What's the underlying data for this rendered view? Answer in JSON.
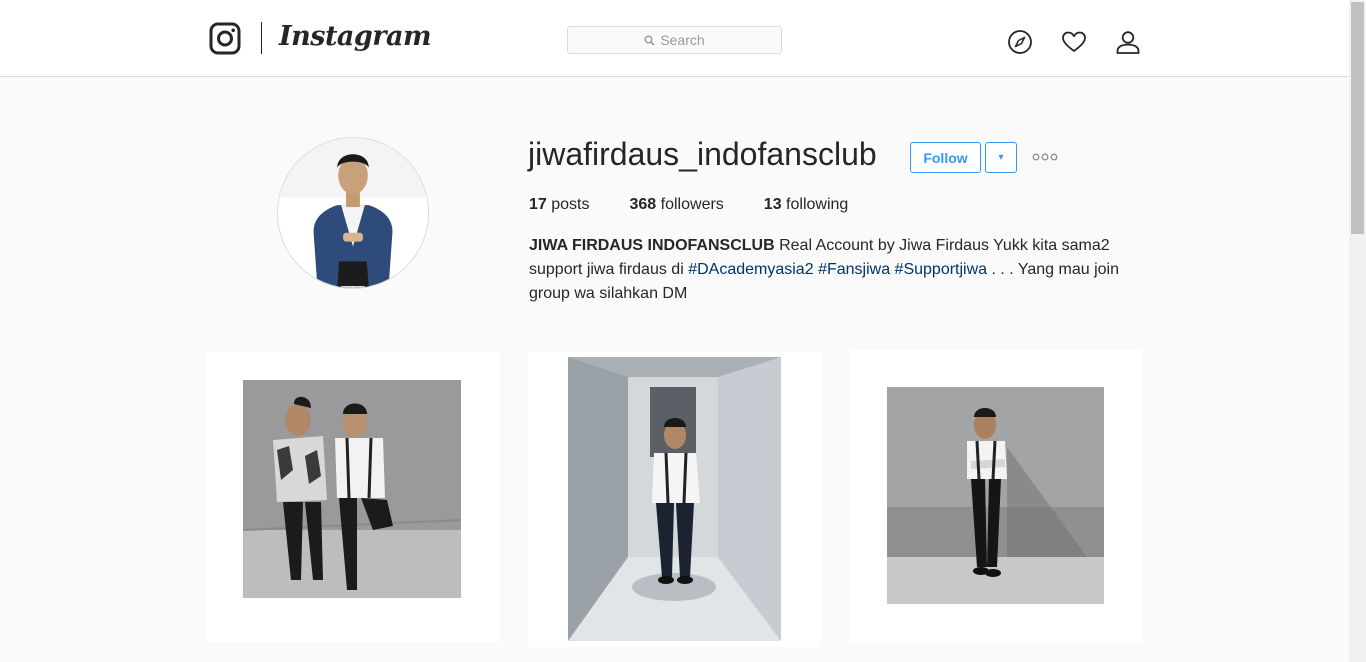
{
  "header": {
    "logo_icon": "instagram-camera-icon",
    "wordmark": "Instagram",
    "search_placeholder": "Search",
    "nav_icons": [
      "compass-icon",
      "heart-icon",
      "user-icon"
    ]
  },
  "profile": {
    "username": "jiwafirdaus_indofansclub",
    "follow_label": "Follow",
    "dropdown_symbol": "▾",
    "more_icon": "ellipsis-icon",
    "stats": {
      "posts_count": "17",
      "posts_label": "posts",
      "followers_count": "368",
      "followers_label": "followers",
      "following_count": "13",
      "following_label": "following"
    },
    "bio": {
      "name": "JIWA FIRDAUS INDOFANSCLUB",
      "text_1": "Real Account by Jiwa Firdaus Yukk kita sama2 support jiwa firdaus di",
      "tags": [
        "#DAcademyasia2",
        "#Fansjiwa",
        "#Supportjiwa"
      ],
      "text_2": ". . . Yang mau join group wa silahkan DM"
    }
  },
  "posts": [
    {
      "subject": "two men posing against grey wall"
    },
    {
      "subject": "man in bow tie standing in corridor"
    },
    {
      "subject": "man in bow tie leaning on grey wall"
    }
  ],
  "colors": {
    "accent": "#3897f0",
    "hashtag": "#003569",
    "background": "#fafafa",
    "border": "#dbdbdb"
  }
}
